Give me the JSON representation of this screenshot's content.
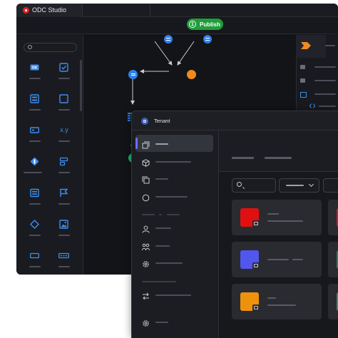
{
  "studio": {
    "title": "ODC Studio",
    "publish": {
      "badge": "1",
      "label": "Publish"
    },
    "toolbox": {
      "icons": [
        "ok-icon",
        "checkbox-icon",
        "form-icon",
        "container-icon",
        "input-icon",
        "expression-icon",
        "dropdown-icon",
        "layout-icon",
        "table-icon",
        "flag-icon",
        "if-icon",
        "image-icon",
        "input-field-icon",
        "button-group-icon"
      ],
      "expression_glyph": "x.y",
      "ok_glyph": "OK"
    }
  },
  "tenant": {
    "title": "Tenant"
  },
  "colors": {
    "publish": "#1f9d3a",
    "accent_blue": "#3d8ef0",
    "flow_orange": "#f08a1e",
    "flow_green": "#1fb36a",
    "nav_active": "#6e6ef5",
    "tile_red": "#e01010",
    "tile_blue": "#5156ee",
    "tile_orange": "#ee920d"
  }
}
